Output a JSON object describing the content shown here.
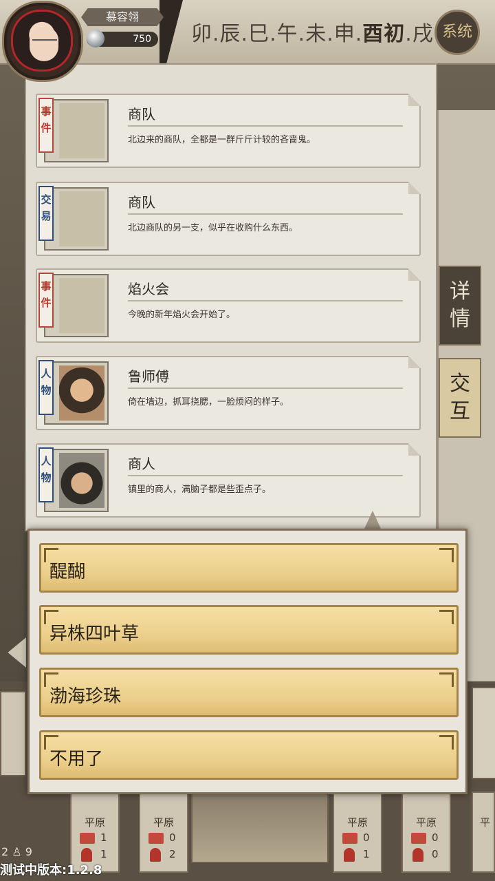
{
  "player": {
    "name": "慕容翎",
    "money": "750"
  },
  "time": {
    "slots": [
      "卯",
      "辰",
      "巳",
      "午",
      "未",
      "申",
      "酉初",
      "戌"
    ],
    "separator": "."
  },
  "system_button": "系统",
  "side_tabs": {
    "detail": "详情",
    "interact": "交互"
  },
  "cards": [
    {
      "tag": "事件",
      "tag_type": "event",
      "title": "商队",
      "desc": "北边来的商队，全都是一群斤斤计较的吝啬鬼。",
      "icon": "caravan-cart-icon"
    },
    {
      "tag": "交易",
      "tag_type": "trade",
      "title": "商队",
      "desc": "北边商队的另一支，似乎在收购什么东西。",
      "icon": "caravan-cart-icon"
    },
    {
      "tag": "事件",
      "tag_type": "event",
      "title": "焰火会",
      "desc": "今晚的新年焰火会开始了。",
      "icon": "festival-stage-icon"
    },
    {
      "tag": "人物",
      "tag_type": "person",
      "title": "鲁师傅",
      "desc": "倚在墙边，抓耳挠腮，一脸烦闷的样子。",
      "icon": "man-portrait-icon"
    },
    {
      "tag": "人物",
      "tag_type": "person",
      "title": "商人",
      "desc": "镇里的商人，满脑子都是些歪点子。",
      "icon": "merchant-portrait-icon"
    }
  ],
  "choices": [
    "醍醐",
    "异株四叶草",
    "渤海珍珠",
    "不用了"
  ],
  "map_slots": [
    {
      "label": "平原",
      "a": "1",
      "b": "1"
    },
    {
      "label": "平原",
      "a": "0",
      "b": "2"
    },
    {
      "label": "平原",
      "a": "0",
      "b": "1"
    },
    {
      "label": "平原",
      "a": "0",
      "b": "0"
    },
    {
      "label": "平",
      "a": "",
      "b": ""
    }
  ],
  "bottom_counts": {
    "left": "2",
    "right": "9"
  },
  "version": "测试中版本:1.2.8",
  "colors": {
    "event_tag": "#b33a2e",
    "trade_tag": "#2f4f7a",
    "choice_gold": "#ecd08c"
  }
}
